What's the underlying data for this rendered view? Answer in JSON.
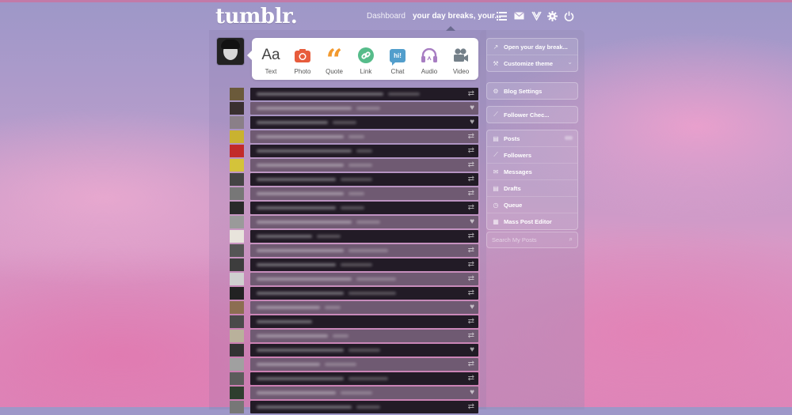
{
  "header": {
    "logo": "tumblr.",
    "nav_dashboard": "Dashboard",
    "nav_blog": "your day breaks, your...",
    "icons": [
      "list-icon",
      "mail-icon",
      "activity-icon",
      "gear-icon",
      "power-icon"
    ]
  },
  "post_types": [
    {
      "label": "Text",
      "icon": "text-icon",
      "glyph": "Aa",
      "color": "#444444"
    },
    {
      "label": "Photo",
      "icon": "photo-icon",
      "color": "#e75c3c"
    },
    {
      "label": "Quote",
      "icon": "quote-icon",
      "glyph": "“",
      "color": "#f2992e"
    },
    {
      "label": "Link",
      "icon": "link-icon",
      "color": "#56bc8a"
    },
    {
      "label": "Chat",
      "icon": "chat-icon",
      "glyph": "hi!",
      "color": "#529ecc"
    },
    {
      "label": "Audio",
      "icon": "audio-icon",
      "color": "#a77dc2"
    },
    {
      "label": "Video",
      "icon": "video-icon",
      "color": "#748089"
    }
  ],
  "feed": {
    "rows": [
      {
        "shade": "dark",
        "action": "⇄"
      },
      {
        "shade": "light",
        "action": "♥"
      },
      {
        "shade": "dark",
        "action": "♥"
      },
      {
        "shade": "light",
        "action": "⇄"
      },
      {
        "shade": "dark",
        "action": "⇄"
      },
      {
        "shade": "light",
        "action": "⇄"
      },
      {
        "shade": "dark",
        "action": "⇄"
      },
      {
        "shade": "light",
        "action": "⇄"
      },
      {
        "shade": "dark",
        "action": "⇄"
      },
      {
        "shade": "light",
        "action": "♥"
      },
      {
        "shade": "dark",
        "action": "⇄"
      },
      {
        "shade": "light",
        "action": "⇄"
      },
      {
        "shade": "dark",
        "action": "⇄"
      },
      {
        "shade": "light",
        "action": "⇄"
      },
      {
        "shade": "dark",
        "action": "⇄"
      },
      {
        "shade": "light",
        "action": "♥"
      },
      {
        "shade": "dark",
        "action": "⇄"
      },
      {
        "shade": "light",
        "action": "⇄"
      },
      {
        "shade": "dark",
        "action": "♥"
      },
      {
        "shade": "light",
        "action": "⇄"
      },
      {
        "shade": "dark",
        "action": "⇄"
      },
      {
        "shade": "light",
        "action": "♥"
      },
      {
        "shade": "dark",
        "action": "⇄"
      }
    ]
  },
  "sidebar": {
    "blog_actions": [
      {
        "label": "Open your day break...",
        "icon": "open-external-icon"
      },
      {
        "label": "Customize theme",
        "icon": "wrench-icon"
      }
    ],
    "blog_settings": {
      "label": "Blog Settings",
      "icon": "gear-icon"
    },
    "follower_check": {
      "label": "Follower Chec...",
      "icon": "chart-icon"
    },
    "blog_nav": [
      {
        "label": "Posts",
        "icon": "page-icon"
      },
      {
        "label": "Followers",
        "icon": "chart-icon"
      },
      {
        "label": "Messages",
        "icon": "mail-icon"
      },
      {
        "label": "Drafts",
        "icon": "page-icon"
      },
      {
        "label": "Queue",
        "icon": "clock-icon"
      },
      {
        "label": "Mass Post Editor",
        "icon": "grid-icon"
      }
    ],
    "search_placeholder": "Search My Posts"
  }
}
